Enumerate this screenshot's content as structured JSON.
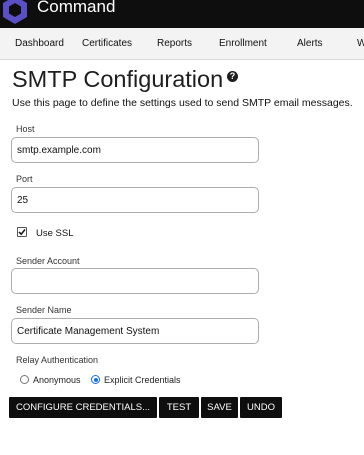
{
  "app": {
    "name": "Command"
  },
  "nav": {
    "items": [
      "Dashboard",
      "Certificates",
      "Reports",
      "Enrollment",
      "Alerts",
      "W"
    ]
  },
  "page": {
    "title": "SMTP Configuration",
    "help_glyph": "?",
    "description": "Use this page to define the settings used to send SMTP email messages."
  },
  "form": {
    "host": {
      "label": "Host",
      "value": "smtp.example.com"
    },
    "port": {
      "label": "Port",
      "value": "25"
    },
    "use_ssl": {
      "label": "Use SSL",
      "checked": true
    },
    "sender_account": {
      "label": "Sender Account",
      "value": ""
    },
    "sender_name": {
      "label": "Sender Name",
      "value": "Certificate Management System"
    },
    "relay_auth": {
      "label": "Relay Authentication",
      "options": [
        "Anonymous",
        "Explicit Credentials"
      ],
      "selected": "Explicit Credentials"
    }
  },
  "buttons": {
    "configure": "CONFIGURE CREDENTIALS...",
    "test": "TEST",
    "save": "SAVE",
    "undo": "UNDO"
  },
  "colors": {
    "topbar": "#0e0e0e",
    "logo": "#5b4fc4",
    "radio_accent": "#1a6fd8",
    "button_bg": "#0e0e0e"
  },
  "icons": [
    "command-logo-icon",
    "help-icon",
    "checkmark-icon"
  ]
}
